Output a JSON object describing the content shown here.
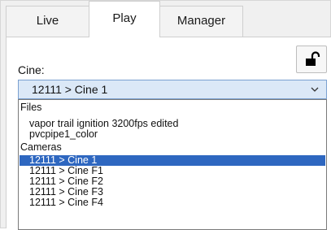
{
  "tabs": {
    "live": "Live",
    "play": "Play",
    "manager": "Manager",
    "active": "play"
  },
  "cine_label": "Cine:",
  "lock_icon": "unlocked-padlock-icon",
  "combo": {
    "value": "12111 > Cine 1",
    "arrow_icon": "chevron-down-icon"
  },
  "dropdown": {
    "files_header": "Files",
    "files": [
      "vapor trail ignition 3200fps edited",
      "pvcpipe1_color"
    ],
    "cameras_header": "Cameras",
    "cameras": [
      "12111 > Cine 1",
      "12111 > Cine F1",
      "12111 > Cine F2",
      "12111 > Cine F3",
      "12111 > Cine F4"
    ],
    "selected": "12111 > Cine 1"
  },
  "colors": {
    "selection": "#2e67c0",
    "combo_background": "#dbe8f7",
    "combo_border": "#7aa0d0"
  }
}
